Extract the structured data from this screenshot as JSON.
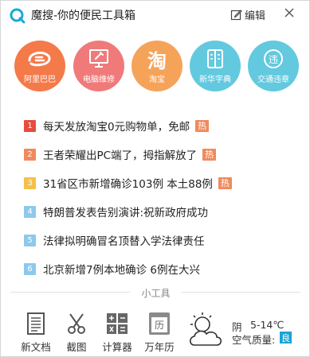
{
  "header": {
    "title": "魔搜-你的便民工具箱",
    "edit_label": "编辑"
  },
  "shortcuts": [
    {
      "label": "阿里巴巴",
      "color": "#f47a4a",
      "icon": "alibaba-logo"
    },
    {
      "label": "电脑维修",
      "color": "#f07a7a",
      "icon": "computer-repair-icon"
    },
    {
      "label": "淘宝",
      "color": "#f6a35a",
      "icon": "taobao-logo",
      "glyph": "淘"
    },
    {
      "label": "新华字典",
      "color": "#62c9df",
      "icon": "dictionary-icon"
    },
    {
      "label": "交通违章",
      "color": "#62c9df",
      "icon": "traffic-violation-icon",
      "glyph": "违"
    }
  ],
  "hot_list": [
    {
      "rank": "1",
      "text": "每天发放淘宝0元购物单，免邮",
      "hot": true,
      "rank_color": "#e84c3d"
    },
    {
      "rank": "2",
      "text": "王者荣耀出PC端了，拇指解放了",
      "hot": true,
      "rank_color": "#f08a5d"
    },
    {
      "rank": "3",
      "text": "31省区市新增确诊103例 本土88例",
      "hot": true,
      "rank_color": "#f5c04a"
    },
    {
      "rank": "4",
      "text": "特朗普发表告别演讲:祝新政府成功",
      "hot": false,
      "rank_color": "#8ec9ec"
    },
    {
      "rank": "5",
      "text": "法律拟明确冒名顶替入学法律责任",
      "hot": false,
      "rank_color": "#8ec9ec"
    },
    {
      "rank": "6",
      "text": "北京新增7例本地确诊 6例在大兴",
      "hot": false,
      "rank_color": "#8ec9ec"
    }
  ],
  "hot_badge": "热",
  "tools": {
    "title": "小工具",
    "items": [
      {
        "label": "新文档",
        "icon": "document-icon"
      },
      {
        "label": "截图",
        "icon": "scissors-icon"
      },
      {
        "label": "计算器",
        "icon": "calculator-icon"
      },
      {
        "label": "万年历",
        "icon": "calendar-icon",
        "glyph": "历"
      }
    ]
  },
  "weather": {
    "condition": "阴",
    "temperature": "5-14℃",
    "aqi_label": "空气质量:",
    "aqi_value": "良",
    "icon": "cloudy-icon"
  }
}
